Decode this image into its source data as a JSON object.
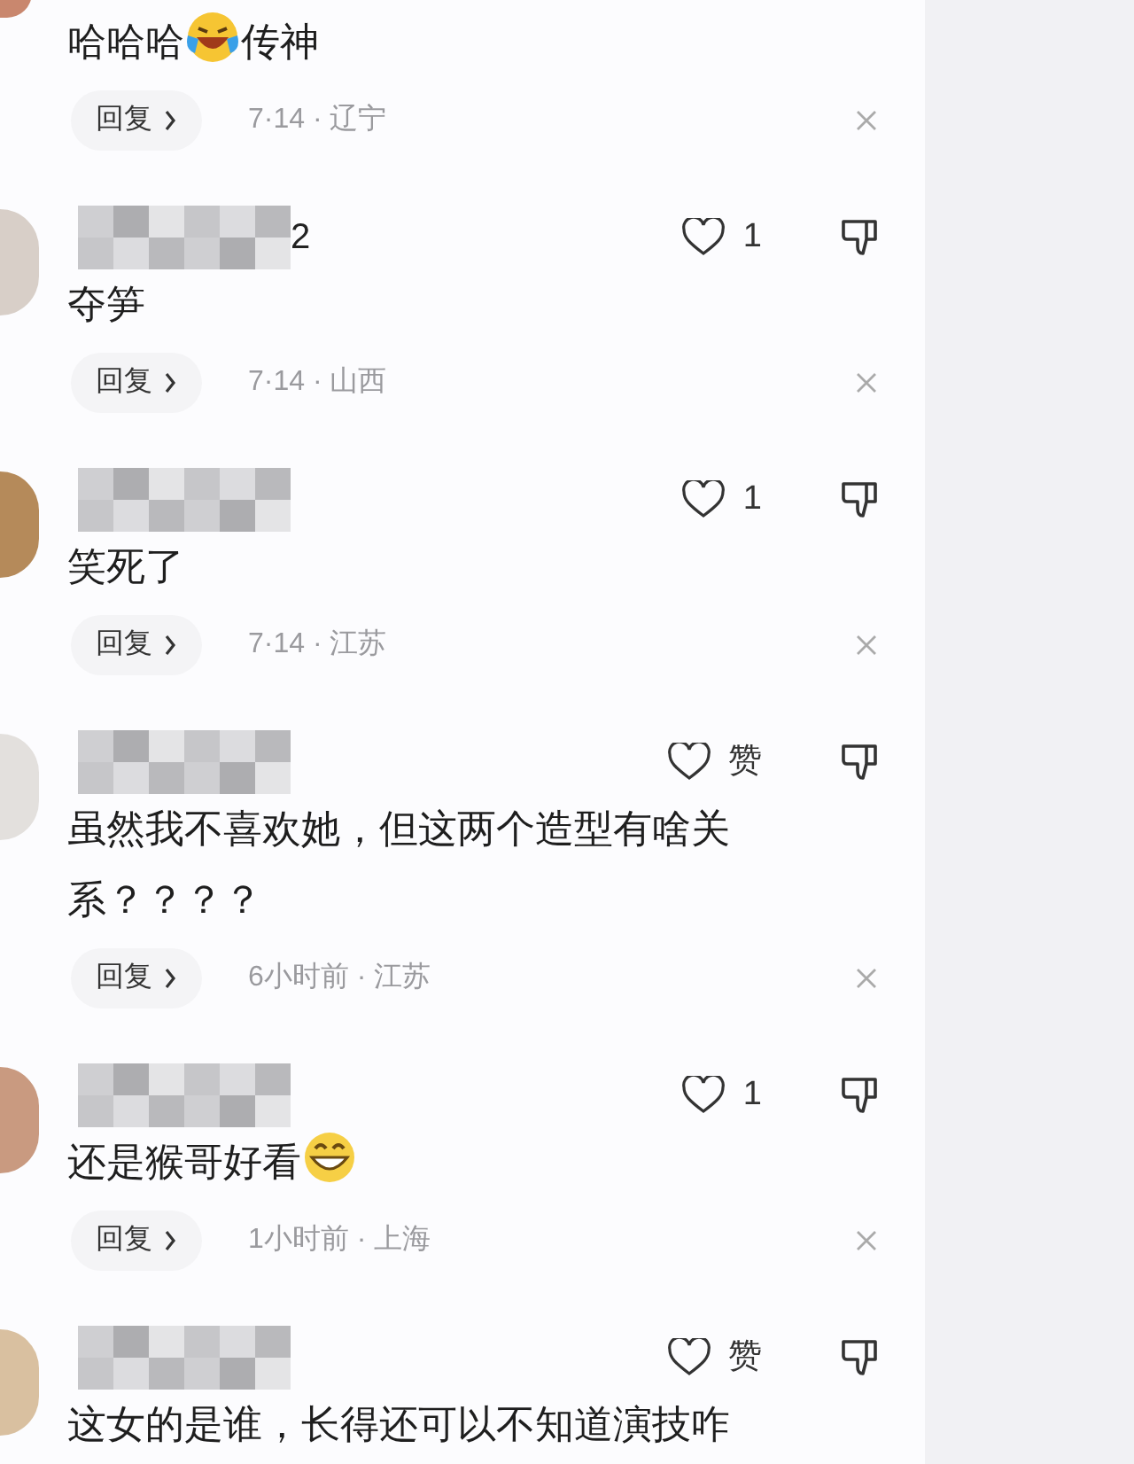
{
  "comments": [
    {
      "text": [
        {
          "kind": "text",
          "text": "哈哈哈"
        },
        {
          "kind": "laugh_cry_emoji"
        },
        {
          "kind": "text",
          "text": "传神"
        }
      ],
      "reply": "回复",
      "meta": "7·14 · 辽宁"
    },
    {
      "name_suffix": "2",
      "likes": "1",
      "text": [
        {
          "kind": "text",
          "text": "夺笋"
        }
      ],
      "reply": "回复",
      "meta": "7·14 · 山西"
    },
    {
      "likes": "1",
      "text": [
        {
          "kind": "text",
          "text": "笑死了"
        }
      ],
      "reply": "回复",
      "meta": "7·14 · 江苏"
    },
    {
      "likes": "赞",
      "text": [
        {
          "kind": "text",
          "text": "虽然我不喜欢她，但这两个造型有啥关系？？？？"
        }
      ],
      "reply": "回复",
      "meta": "6小时前 · 江苏"
    },
    {
      "likes": "1",
      "text": [
        {
          "kind": "text",
          "text": "还是猴哥好看"
        },
        {
          "kind": "grin_emoji"
        }
      ],
      "reply": "回复",
      "meta": "1小时前 · 上海"
    },
    {
      "likes": "赞",
      "text": [
        {
          "kind": "text",
          "text": "这女的是谁，长得还可以不知道演技咋"
        }
      ]
    }
  ]
}
